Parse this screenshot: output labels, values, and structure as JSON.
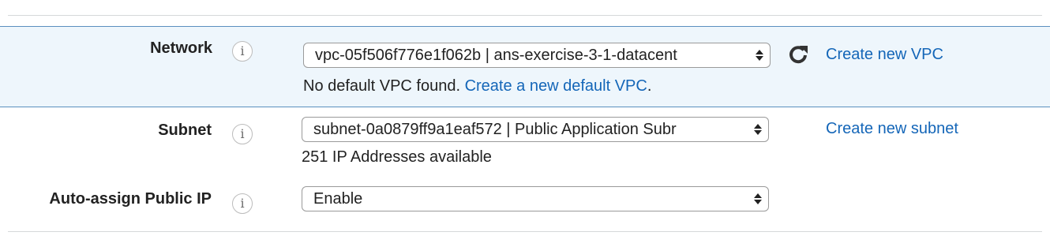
{
  "network": {
    "label": "Network",
    "info_icon": "info-icon",
    "selected_value": "vpc-05f506f776e1f062b | ans-exercise-3-1-datacent",
    "refresh_icon": "refresh-icon",
    "create_link": "Create new VPC",
    "helper_text": "No default VPC found.",
    "helper_link": "Create a new default VPC",
    "helper_suffix": "."
  },
  "subnet": {
    "label": "Subnet",
    "info_icon": "info-icon",
    "selected_value": "subnet-0a0879ff9a1eaf572 | Public Application Subr",
    "create_link": "Create new subnet",
    "helper_text": "251 IP Addresses available"
  },
  "auto_assign_public_ip": {
    "label": "Auto-assign Public IP",
    "info_icon": "info-icon",
    "selected_value": "Enable"
  },
  "colors": {
    "link": "#1466b8",
    "band_background": "#eef6fc",
    "band_border": "#5b8fbf"
  }
}
